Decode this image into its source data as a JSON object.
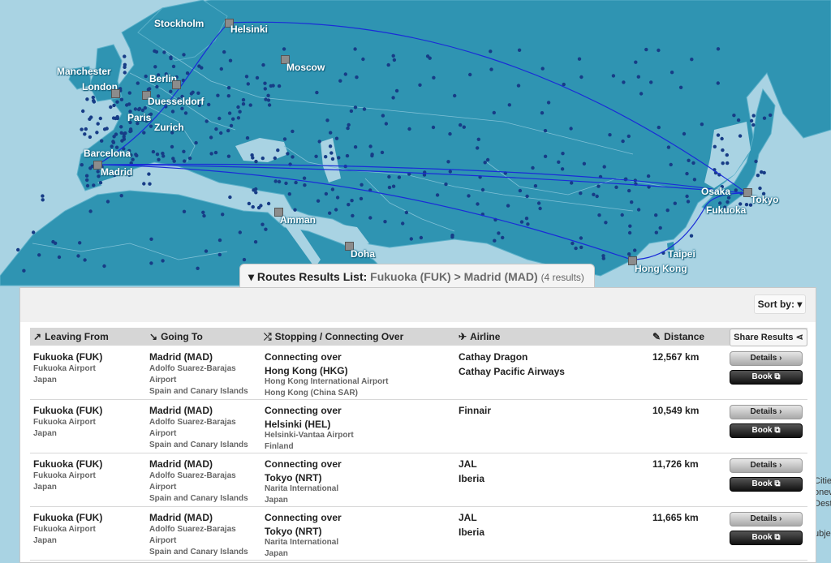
{
  "map": {
    "cities": {
      "stockholm": "Stockholm",
      "helsinki": "Helsinki",
      "manchester": "Manchester",
      "london": "London",
      "berlin": "Berlin",
      "duesseldorf": "Duesseldorf",
      "moscow": "Moscow",
      "paris": "Paris",
      "zurich": "Zurich",
      "barcelona": "Barcelona",
      "madrid": "Madrid",
      "amman": "Amman",
      "doha": "Doha",
      "osaka": "Osaka",
      "tokyo": "Tokyo",
      "fukuoka": "Fukuoka",
      "taipei": "Taipei",
      "hongkong": "Hong Kong"
    },
    "edge_right_text": [
      "Cities",
      "onew",
      "Desti",
      "ubjec"
    ],
    "colors": {
      "sea": "#a9d3e3",
      "land": "#2f94b2",
      "route": "#1a2cd8",
      "airport_dot": "#173c86"
    }
  },
  "results": {
    "tab_prefix": "Routes Results List:",
    "tab_route": "Fukuoka (FUK) > Madrid (MAD)",
    "tab_count": "(4 results)",
    "sort_label": "Sort by:",
    "headers": {
      "leaving": "Leaving From",
      "going": "Going To",
      "stopping": "Stopping / Connecting Over",
      "airline": "Airline",
      "distance": "Distance",
      "share": "Share Results"
    },
    "details_label": "Details",
    "book_label": "Book",
    "rows": [
      {
        "from_code": "Fukuoka (FUK)",
        "from_airport": "Fukuoka Airport",
        "from_country": "Japan",
        "to_code": "Madrid (MAD)",
        "to_airport_1": "Adolfo Suarez-Barajas",
        "to_airport_2": "Airport",
        "to_country": "Spain and Canary Islands",
        "connect_prefix": "Connecting over",
        "via_code": "Hong Kong (HKG)",
        "via_airport": "Hong Kong International Airport",
        "via_country": "Hong Kong (China SAR)",
        "airline_1": "Cathay Dragon",
        "airline_2": "Cathay Pacific Airways",
        "distance": "12,567 km"
      },
      {
        "from_code": "Fukuoka (FUK)",
        "from_airport": "Fukuoka Airport",
        "from_country": "Japan",
        "to_code": "Madrid (MAD)",
        "to_airport_1": "Adolfo Suarez-Barajas",
        "to_airport_2": "Airport",
        "to_country": "Spain and Canary Islands",
        "connect_prefix": "Connecting over",
        "via_code": "Helsinki (HEL)",
        "via_airport": "Helsinki-Vantaa Airport",
        "via_country": "Finland",
        "airline_1": "Finnair",
        "airline_2": "",
        "distance": "10,549 km"
      },
      {
        "from_code": "Fukuoka (FUK)",
        "from_airport": "Fukuoka Airport",
        "from_country": "Japan",
        "to_code": "Madrid (MAD)",
        "to_airport_1": "Adolfo Suarez-Barajas",
        "to_airport_2": "Airport",
        "to_country": "Spain and Canary Islands",
        "connect_prefix": "Connecting over",
        "via_code": "Tokyo (NRT)",
        "via_airport": "Narita International",
        "via_country": "Japan",
        "airline_1": "JAL",
        "airline_2": "Iberia",
        "distance": "11,726 km"
      },
      {
        "from_code": "Fukuoka (FUK)",
        "from_airport": "Fukuoka Airport",
        "from_country": "Japan",
        "to_code": "Madrid (MAD)",
        "to_airport_1": "Adolfo Suarez-Barajas",
        "to_airport_2": "Airport",
        "to_country": "Spain and Canary Islands",
        "connect_prefix": "Connecting over",
        "via_code": "Tokyo (NRT)",
        "via_airport": "Narita International",
        "via_country": "Japan",
        "airline_1": "JAL",
        "airline_2": "Iberia",
        "distance": "11,665 km"
      }
    ]
  }
}
